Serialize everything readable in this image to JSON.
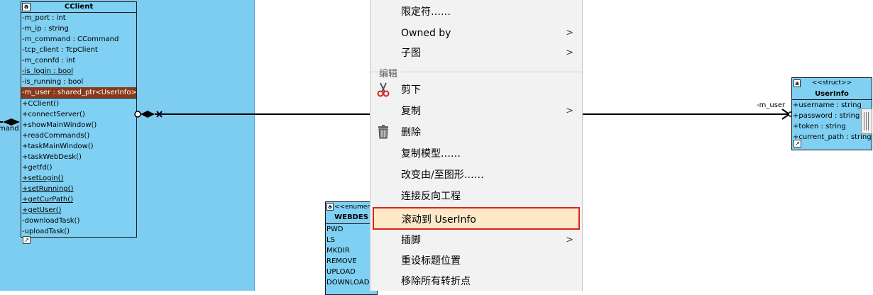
{
  "cclient": {
    "name": "CClient",
    "attributes": [
      "-m_port : int",
      "-m_ip : string",
      "-m_command : CCommand",
      "-tcp_client : TcpClient",
      "-m_connfd : int",
      "-is_login : bool",
      "-is_running : bool",
      "-m_user : shared_ptr<UserInfo>"
    ],
    "methods": [
      "+CClient()",
      "+connectServer()",
      "+showMainWindow()",
      "+readCommands()",
      "+taskMainWindow()",
      "+taskWebDesk()",
      "+getfd()",
      "+setLogin()",
      "+setRunning()",
      "+getCurPath()",
      "+getUser()",
      "-downloadTask()",
      "-uploadTask()"
    ]
  },
  "left_label": "mand",
  "enum_box": {
    "stereotype": "<<enumerat",
    "name": "WEBDES",
    "values": [
      "PWD",
      "LS",
      "MKDIR",
      "REMOVE",
      "UPLOAD",
      "DOWNLOAD"
    ]
  },
  "userinfo": {
    "stereotype": "<<struct>>",
    "name": "UserInfo",
    "attributes": [
      "+username : string",
      "+password : string",
      "+token : string",
      "+current_path : string"
    ]
  },
  "assoc_label": "-m_user",
  "menu": {
    "items": [
      {
        "label": "限定符……",
        "arrow": ""
      },
      {
        "label": "Owned by",
        "arrow": ">"
      },
      {
        "label": "子图",
        "arrow": ">"
      }
    ],
    "group_label": "编辑",
    "edit_items": [
      {
        "label": "剪下",
        "arrow": "",
        "icon": "scissors-icon"
      },
      {
        "label": "复制",
        "arrow": ">",
        "icon": ""
      },
      {
        "label": "删除",
        "arrow": "",
        "icon": "trash-icon"
      },
      {
        "label": "复制模型……",
        "arrow": "",
        "icon": ""
      },
      {
        "label": "改变由/至图形……",
        "arrow": "",
        "icon": ""
      },
      {
        "label": "连接反向工程",
        "arrow": "",
        "icon": ""
      },
      {
        "label": "滚动到 UserInfo",
        "arrow": "",
        "icon": ""
      },
      {
        "label": "插脚",
        "arrow": ">",
        "icon": ""
      },
      {
        "label": "重设标题位置",
        "arrow": "",
        "icon": ""
      },
      {
        "label": "移除所有转折点",
        "arrow": "",
        "icon": ""
      }
    ]
  }
}
